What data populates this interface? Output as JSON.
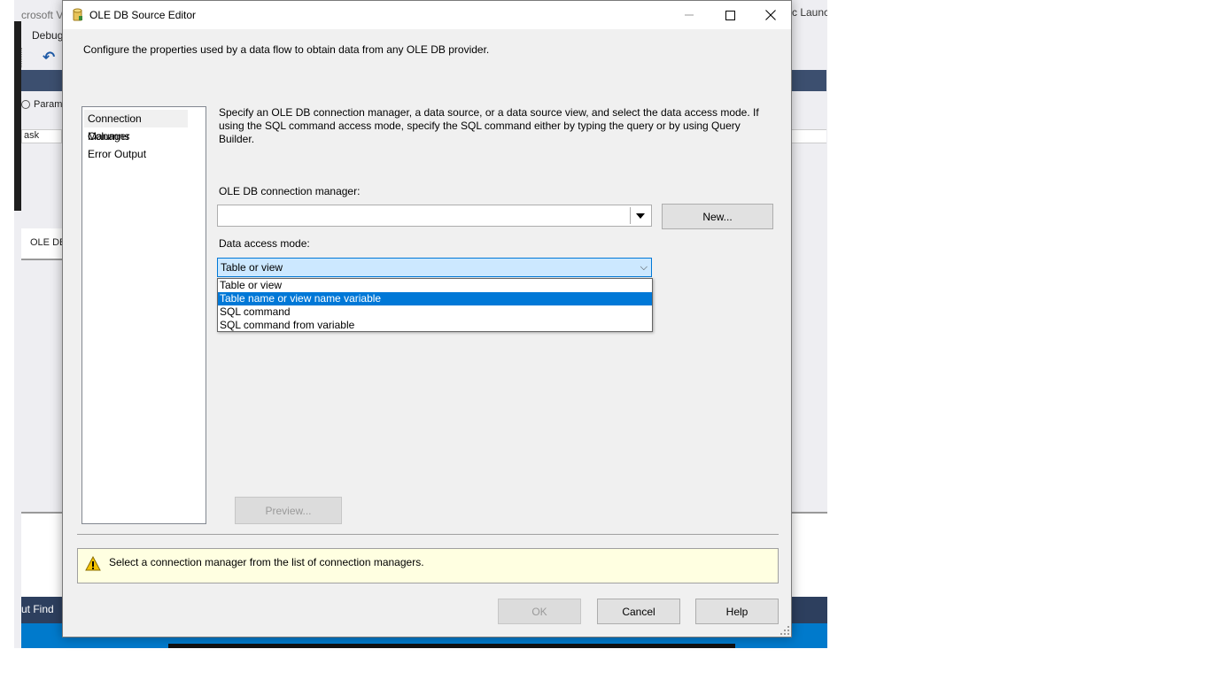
{
  "background": {
    "title_left": "crosoft V",
    "title_right": "c Launc",
    "menu_debug": "Debug",
    "param_label": "Param",
    "task_label": "ask",
    "oledb_tab": "OLE DB",
    "status_text": "ut   Find"
  },
  "dialog": {
    "title": "OLE DB Source Editor",
    "description": "Configure the properties used by a data flow to obtain data from any OLE DB provider.",
    "nav": {
      "items": [
        {
          "label": "Connection Manager"
        },
        {
          "label": "Columns"
        },
        {
          "label": "Error Output"
        }
      ]
    },
    "info_text": "Specify an OLE DB connection manager, a data source, or a data source view, and select the data access mode. If using the SQL command access mode, specify the SQL command either by typing the query or by using Query Builder.",
    "connection_label": "OLE DB connection manager:",
    "connection_value": "",
    "new_button": "New...",
    "access_mode_label": "Data access mode:",
    "access_mode_value": "Table or view",
    "access_mode_options": [
      "Table or view",
      "Table name or view name variable",
      "SQL command",
      "SQL command from variable"
    ],
    "highlighted_option": "Table name or view name variable",
    "preview_button": "Preview...",
    "warning_text": "Select a connection manager from the list of connection managers.",
    "ok_button": "OK",
    "cancel_button": "Cancel",
    "help_button": "Help"
  },
  "colors": {
    "selection_blue": "#0078d7",
    "select_highlight": "#cce8ff",
    "warning_bg": "#ffffe1"
  }
}
